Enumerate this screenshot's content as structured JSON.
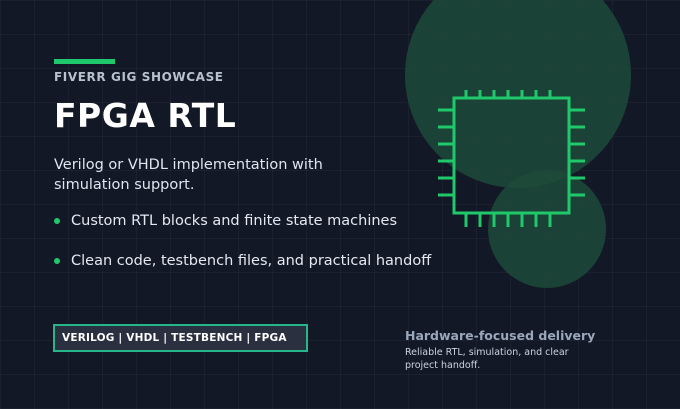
{
  "eyebrow": "FIVERR GIG SHOWCASE",
  "title": "FPGA RTL",
  "subtitle": "Verilog or VHDL implementation with simulation support.",
  "bullets": [
    "Custom RTL blocks and finite state machines",
    "Clean code, testbench files, and practical handoff"
  ],
  "tags": "VERILOG | VHDL | TESTBENCH | FPGA",
  "delivery": {
    "heading": "Hardware-focused delivery",
    "body": "Reliable RTL, simulation, and clear project handoff."
  },
  "icons": {
    "chip": "chip-icon"
  },
  "colors": {
    "background": "#131826",
    "accent_green": "#1fc86a",
    "glow": "#1d4a3a",
    "tag_border": "#27b68a"
  }
}
